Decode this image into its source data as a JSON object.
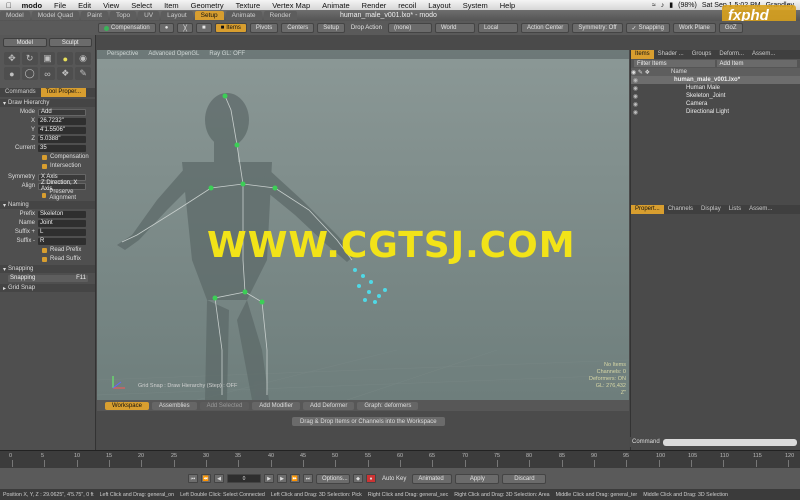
{
  "menubar": {
    "app": "modo",
    "items": [
      "File",
      "Edit",
      "View",
      "Select",
      "Item",
      "Geometry",
      "Texture",
      "Vertex Map",
      "Animate",
      "Render",
      "recoil",
      "Layout",
      "System",
      "Help"
    ],
    "battery": "(98%)",
    "clock": "Sat Sep 1  5:02 PM",
    "user": "Grandley"
  },
  "window": {
    "title": "human_male_v001.lxo* - modo",
    "tabs": [
      "Model",
      "Model Quad",
      "Paint",
      "Topo",
      "UV",
      "Layout",
      "Setup",
      "Animate",
      "Render"
    ],
    "active_tab": "Setup"
  },
  "logo": {
    "text": "fxphd"
  },
  "toolbar": {
    "compensation": "Compensation",
    "items": "Items",
    "pivots": "Pivots",
    "centers": "Centers",
    "setup": "Setup",
    "drop_action_label": "Drop Action",
    "drop_action_value": "(none)",
    "world": "World",
    "local": "Local",
    "action_center": "Action Center",
    "symmetry": "Symmetry: Off",
    "snapping": "Snapping",
    "work_plane": "Work Plane",
    "goz": "GoZ"
  },
  "toolbox": {
    "model": "Model",
    "sculpt": "Sculpt"
  },
  "left_panel": {
    "tabs": [
      "Commands",
      "Tool Proper..."
    ],
    "active_tab": "Tool Proper...",
    "draw_hierarchy": "Draw Hierarchy",
    "mode_label": "Mode",
    "mode_value": "Add",
    "x_label": "X",
    "x_value": "26.7232\"",
    "y_label": "Y",
    "y_value": "4'1.5506\"",
    "z_label": "Z",
    "z_value": "5.0388\"",
    "current_label": "Current",
    "current_value": "35",
    "compensation": "Compensation",
    "intersection": "Intersection",
    "symmetry_label": "Symmetry",
    "symmetry_value": "X Axis",
    "align_label": "Align",
    "align_value": "Z Direction, X Axis",
    "preserve_alignment": "Preserve Alignment",
    "naming": "Naming",
    "prefix_label": "Prefix",
    "prefix_value": "Skeleton",
    "name_label": "Name",
    "name_value": "Joint",
    "suffix1_label": "Suffix +",
    "suffix1_value": "L",
    "suffix2_label": "Suffix -",
    "suffix2_value": "R",
    "read_prefix": "Read Prefix",
    "read_suffix": "Read Suffix",
    "snapping_section": "Snapping",
    "snapping_button": "Snapping",
    "snapping_key": "F11",
    "grid_snap": "Grid Snap"
  },
  "viewport": {
    "tabs": [
      "Perspective",
      "Advanced OpenGL",
      "Ray GL: OFF"
    ],
    "watermark": "WWW.CGTSJ.COM",
    "info": [
      "No Items",
      "Channels: 0",
      "Deformers: ON",
      "GL: 276,432",
      "Z\""
    ],
    "bottom_status": "Grid Snap : Draw Hierarchy (Step) : OFF"
  },
  "workspace": {
    "tabs": [
      "Workspace",
      "Assemblies",
      "Add Selected",
      "Add Modifier",
      "Add Deformer",
      "Graph: deformers"
    ],
    "drop_hint": "Drag & Drop Items or Channels into the Workspace"
  },
  "right_panel": {
    "tabs": [
      "Items",
      "Shader ...",
      "Groups",
      "Deform...",
      "Assem..."
    ],
    "active_tab": "Items",
    "filter": "Filter Items",
    "add_item": "Add Item",
    "col_name": "Name",
    "items": [
      {
        "name": "human_male_v001.lxo*",
        "bold": true,
        "indent": 0
      },
      {
        "name": "Human Male",
        "bold": false,
        "indent": 1
      },
      {
        "name": "Skeleton_Joint",
        "bold": false,
        "indent": 1
      },
      {
        "name": "Camera",
        "bold": false,
        "indent": 1
      },
      {
        "name": "Directional Light",
        "bold": false,
        "indent": 1
      }
    ],
    "lower_tabs": [
      "Propert...",
      "Channels",
      "Display",
      "Lists",
      "Assem..."
    ],
    "lower_active": "Propert...",
    "command_label": "Command"
  },
  "timeline": {
    "ticks": [
      "0",
      "5",
      "10",
      "15",
      "20",
      "25",
      "30",
      "35",
      "40",
      "45",
      "50",
      "55",
      "60",
      "65",
      "70",
      "75",
      "80",
      "85",
      "90",
      "95",
      "100",
      "105",
      "110",
      "115",
      "120"
    ]
  },
  "playbar": {
    "frame": "0",
    "options": "Options...",
    "auto_key": "Auto Key",
    "animated": "Animated",
    "apply": "Apply",
    "discard": "Discard"
  },
  "statusbar": {
    "position": "Position X, Y, Z :  29.0625\", 4'5.75\", 0 ft",
    "hints": [
      "Left Click and Drag: general_on",
      "Left Double Click: Select Connected",
      "Left Click and Drag: 3D Selection: Pick",
      "Right Click and Drag: general_sec",
      "Right Click and Drag: 3D Selection: Area",
      "Middle Click and Drag: general_ter",
      "Middle Click and Drag: 3D Selection"
    ]
  }
}
